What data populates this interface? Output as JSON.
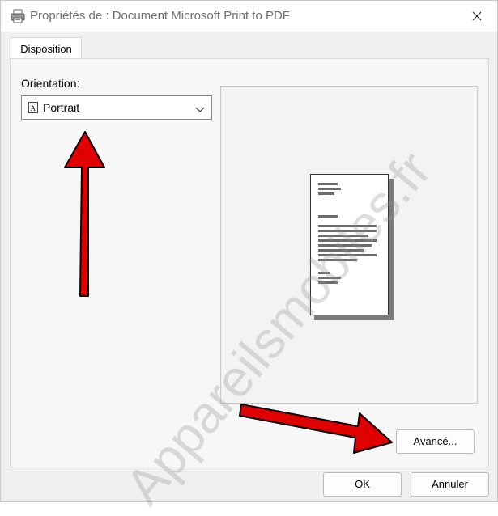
{
  "window": {
    "title": "Propriétés de : Document Microsoft Print to PDF"
  },
  "tabs": [
    {
      "label": "Disposition"
    }
  ],
  "orientation": {
    "label": "Orientation:",
    "selected": "Portrait"
  },
  "buttons": {
    "advanced": "Avancé...",
    "ok": "OK",
    "cancel": "Annuler"
  },
  "watermark": "Appareilsmobiles.fr",
  "icons": {
    "title": "printer-icon",
    "close": "close-icon",
    "select_item": "portrait-page-icon",
    "dropdown": "chevron-down-icon"
  },
  "colors": {
    "annotation_arrow": "#e00000"
  }
}
